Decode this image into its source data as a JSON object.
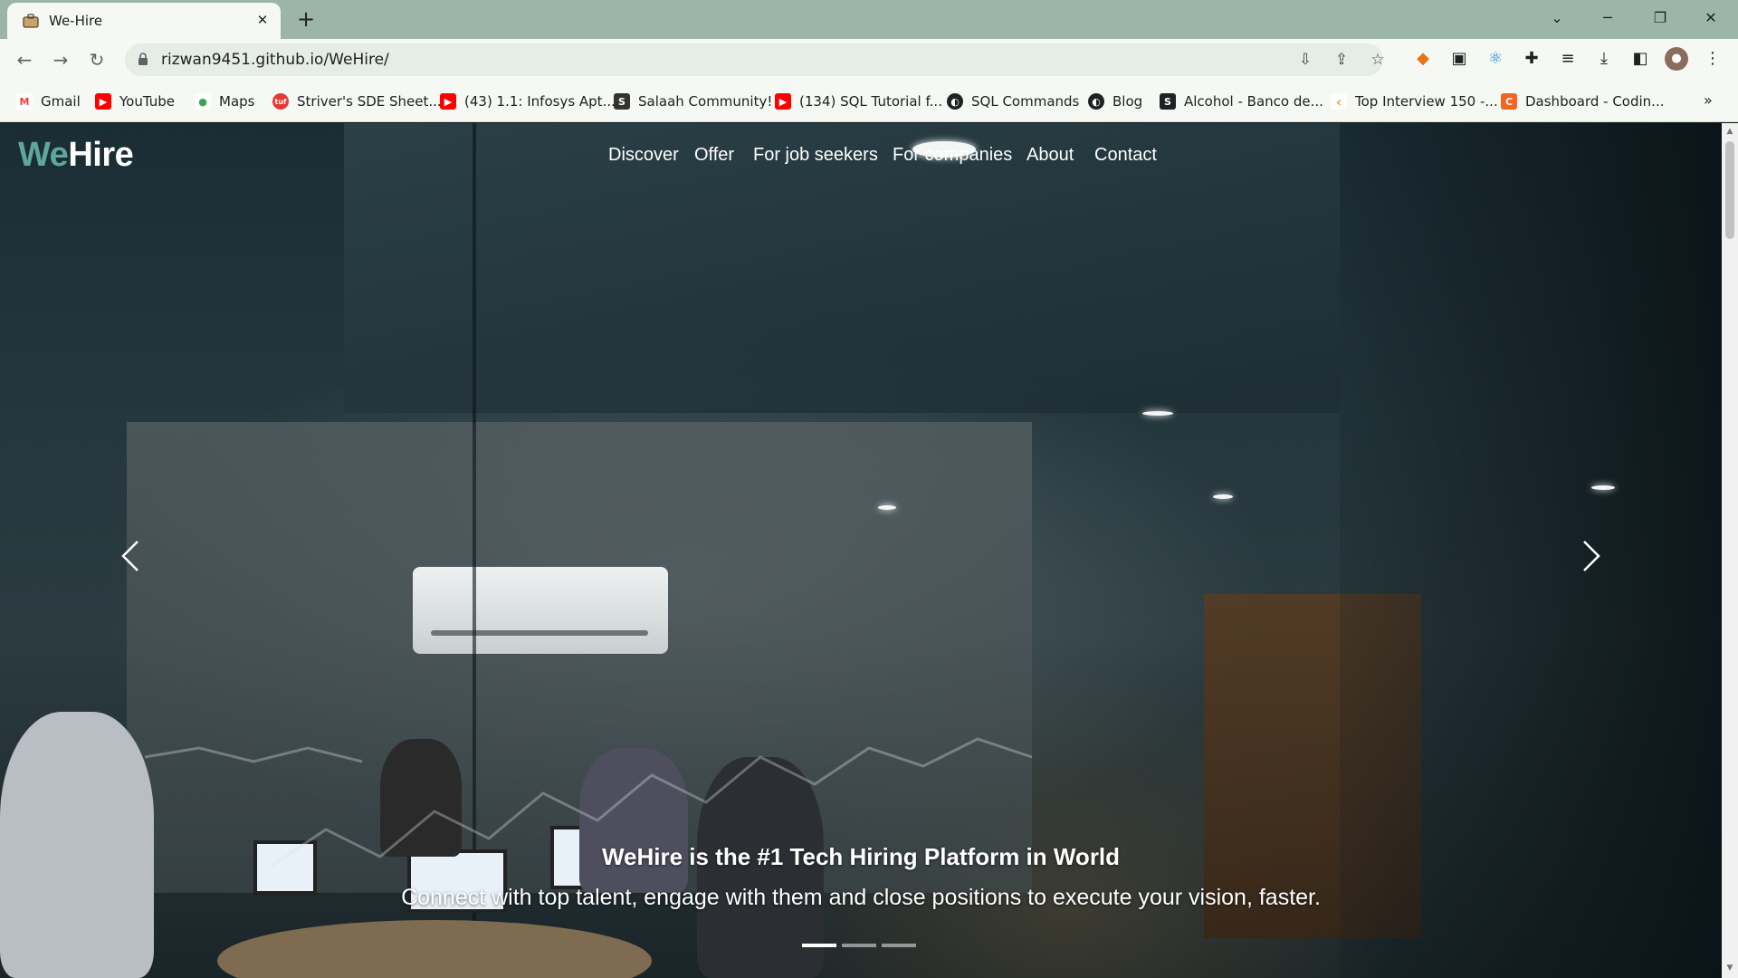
{
  "browser": {
    "tab_title": "We-Hire",
    "tab_close": "✕",
    "new_tab": "+",
    "url": "rizwan9451.github.io/WeHire/",
    "window_controls": {
      "minimize": "─",
      "restore": "❐",
      "close": "✕",
      "tab_search": "⌄"
    },
    "nav": {
      "back": "←",
      "forward": "→",
      "reload": "↻"
    }
  },
  "bookmarks": [
    {
      "label": "Gmail",
      "icon": "M",
      "color": "#ea4335"
    },
    {
      "label": "YouTube",
      "icon": "▶",
      "color": "#ff0000"
    },
    {
      "label": "Maps",
      "icon": "●",
      "color": "#34a853"
    },
    {
      "label": "Striver's SDE Sheet...",
      "icon": "tuf",
      "color": "#e53935"
    },
    {
      "label": "(43) 1.1: Infosys Apt...",
      "icon": "▶",
      "color": "#ff0000"
    },
    {
      "label": "Salaah Community!",
      "icon": "S",
      "color": "#333333"
    },
    {
      "label": "(134) SQL Tutorial f...",
      "icon": "▶",
      "color": "#ff0000"
    },
    {
      "label": "SQL Commands",
      "icon": "◐",
      "color": "#202124"
    },
    {
      "label": "Blog",
      "icon": "◐",
      "color": "#202124"
    },
    {
      "label": "Alcohol - Banco de...",
      "icon": "S",
      "color": "#202124"
    },
    {
      "label": "Top Interview 150 -...",
      "icon": "‹",
      "color": "#f5a623"
    },
    {
      "label": "Dashboard - Codin...",
      "icon": "C",
      "color": "#f26522"
    }
  ],
  "bookmarks_more": "»",
  "site": {
    "logo_we": "We",
    "logo_hire": "Hire",
    "nav": [
      "Discover",
      "Offer",
      "For job seekers",
      "For companies",
      "About",
      "Contact"
    ],
    "carousel": {
      "title": "WeHire is the #1 Tech Hiring Platform in World",
      "subtitle": "Connect with top talent, engage with them and close positions to execute your vision, faster.",
      "slides": 3,
      "active_slide": 1
    }
  }
}
